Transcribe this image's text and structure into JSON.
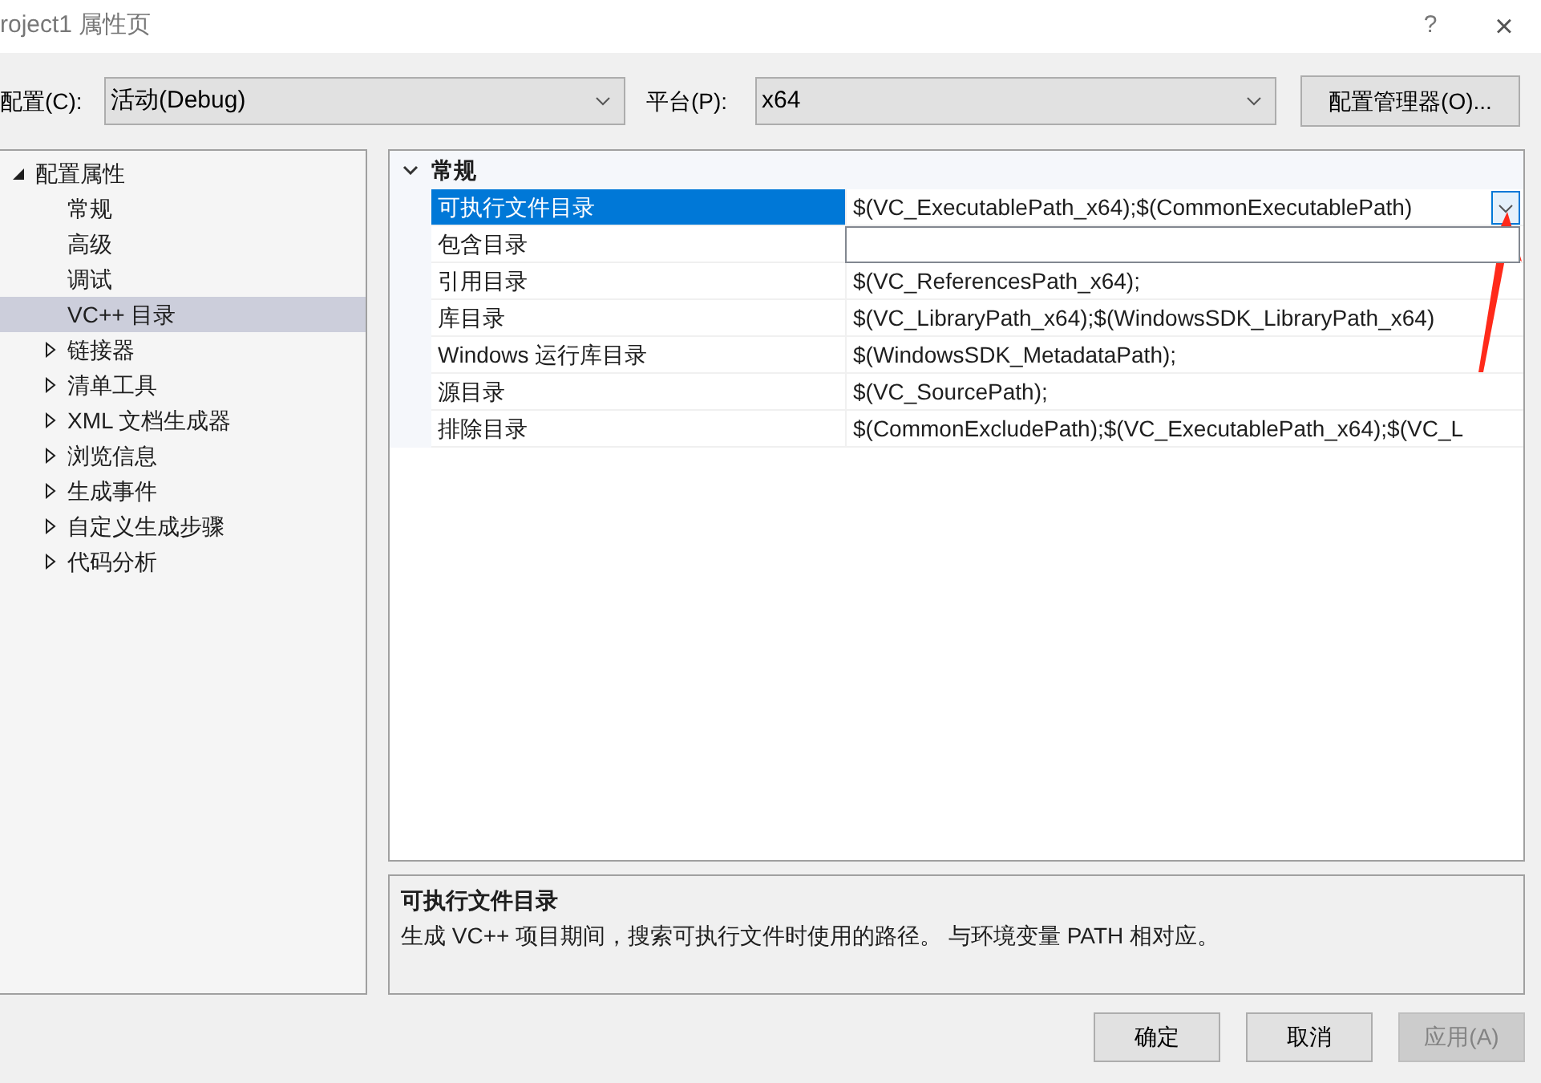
{
  "window": {
    "title": "roject1 属性页",
    "help": "?",
    "close": "×"
  },
  "toolbar": {
    "config_label": "配置(C):",
    "config_value": "活动(Debug)",
    "platform_label": "平台(P):",
    "platform_value": "x64",
    "manager_button": "配置管理器(O)..."
  },
  "tree": [
    {
      "label": "配置属性",
      "kind": "group",
      "expanded": true,
      "selected": false,
      "children": [
        {
          "label": "常规",
          "kind": "leaf",
          "selected": false
        },
        {
          "label": "高级",
          "kind": "leaf",
          "selected": false
        },
        {
          "label": "调试",
          "kind": "leaf",
          "selected": false
        },
        {
          "label": "VC++ 目录",
          "kind": "leaf",
          "selected": true
        },
        {
          "label": "链接器",
          "kind": "group",
          "expanded": false,
          "selected": false
        },
        {
          "label": "清单工具",
          "kind": "group",
          "expanded": false,
          "selected": false
        },
        {
          "label": "XML 文档生成器",
          "kind": "group",
          "expanded": false,
          "selected": false
        },
        {
          "label": "浏览信息",
          "kind": "group",
          "expanded": false,
          "selected": false
        },
        {
          "label": "生成事件",
          "kind": "group",
          "expanded": false,
          "selected": false
        },
        {
          "label": "自定义生成步骤",
          "kind": "group",
          "expanded": false,
          "selected": false
        },
        {
          "label": "代码分析",
          "kind": "group",
          "expanded": false,
          "selected": false
        }
      ]
    }
  ],
  "grid": {
    "category": "常规",
    "expanded": true,
    "dropdown_open": true,
    "rows": [
      {
        "name": "可执行文件目录",
        "value": "$(VC_ExecutablePath_x64);$(CommonExecutablePath)",
        "selected": true
      },
      {
        "name": "包含目录",
        "selected": false
      },
      {
        "name": "引用目录",
        "value": "$(VC_ReferencesPath_x64);",
        "selected": false
      },
      {
        "name": "库目录",
        "value": "$(VC_LibraryPath_x64);$(WindowsSDK_LibraryPath_x64)",
        "selected": false
      },
      {
        "name": "Windows 运行库目录",
        "value": "$(WindowsSDK_MetadataPath);",
        "selected": false
      },
      {
        "name": "源目录",
        "value": "$(VC_SourcePath);",
        "selected": false
      },
      {
        "name": "排除目录",
        "value": "$(CommonExcludePath);$(VC_ExecutablePath_x64);$(VC_L",
        "selected": false
      }
    ]
  },
  "description": {
    "title": "可执行文件目录",
    "text": "生成 VC++ 项目期间，搜索可执行文件时使用的路径。 与环境变量 PATH 相对应。"
  },
  "buttons": [
    {
      "label": "确定",
      "disabled": false
    },
    {
      "label": "取消",
      "disabled": false
    },
    {
      "label": "应用(A)",
      "disabled": true
    }
  ]
}
